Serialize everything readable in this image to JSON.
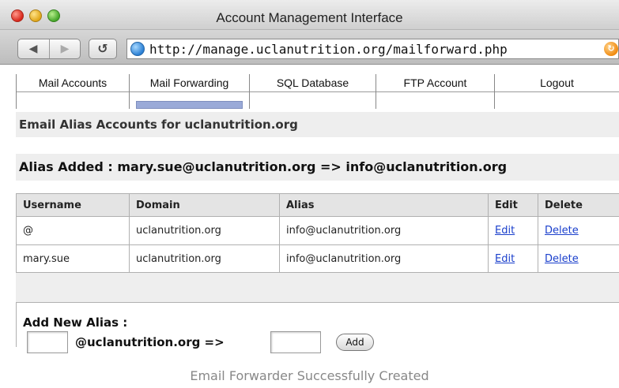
{
  "window": {
    "title": "Account Management Interface"
  },
  "toolbar": {
    "back_icon": "◀",
    "forward_icon": "▶",
    "reload_icon": "↺",
    "url": "http://manage.uclanutrition.org/mailforward.php",
    "go_icon": "↻"
  },
  "nav": {
    "items": [
      {
        "label": "Mail Accounts"
      },
      {
        "label": "Mail Forwarding",
        "active": true
      },
      {
        "label": "SQL Database"
      },
      {
        "label": "FTP Account"
      },
      {
        "label": "Logout"
      }
    ]
  },
  "section": {
    "title": "Email Alias Accounts for uclanutrition.org"
  },
  "status": {
    "message": "Alias Added : mary.sue@uclanutrition.org => info@uclanutrition.org"
  },
  "table": {
    "headers": [
      "Username",
      "Domain",
      "Alias",
      "Edit",
      "Delete"
    ],
    "rows": [
      {
        "username": "@",
        "domain": "uclanutrition.org",
        "alias": "info@uclanutrition.org",
        "edit": "Edit",
        "delete": "Delete"
      },
      {
        "username": "mary.sue",
        "domain": "uclanutrition.org",
        "alias": "info@uclanutrition.org",
        "edit": "Edit",
        "delete": "Delete"
      }
    ]
  },
  "add_form": {
    "title": "Add New Alias :",
    "username_value": "",
    "domain_label": "@uclanutrition.org =>",
    "target_value": "",
    "button_label": "Add"
  },
  "caption": "Email Forwarder Successfully Created"
}
